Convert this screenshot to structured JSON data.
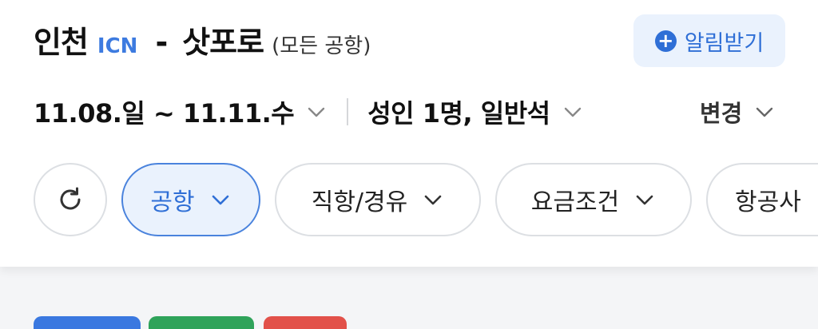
{
  "route": {
    "origin": "인천",
    "origin_code": "ICN",
    "dash": "-",
    "destination": "삿포로",
    "destination_note": "(모든 공항)"
  },
  "alert_button": {
    "label": "알림받기",
    "icon": "plus-circle-icon",
    "color": "#2f6fd6"
  },
  "trip": {
    "dates": "11.08.일 ~ 11.11.수",
    "passengers": "성인 1명, 일반석",
    "change_label": "변경"
  },
  "filters": {
    "refresh_icon": "refresh-icon",
    "chips": [
      {
        "label": "공항",
        "active": true
      },
      {
        "label": "직항/경유",
        "active": false
      },
      {
        "label": "요금조건",
        "active": false
      },
      {
        "label": "항공사",
        "active": false
      }
    ]
  },
  "colors": {
    "accent": "#2f6fd6",
    "accent_bg": "#eaf2fd",
    "badge_blue": "#3a78e0",
    "badge_green": "#2fa35a",
    "badge_red": "#e2514a"
  }
}
